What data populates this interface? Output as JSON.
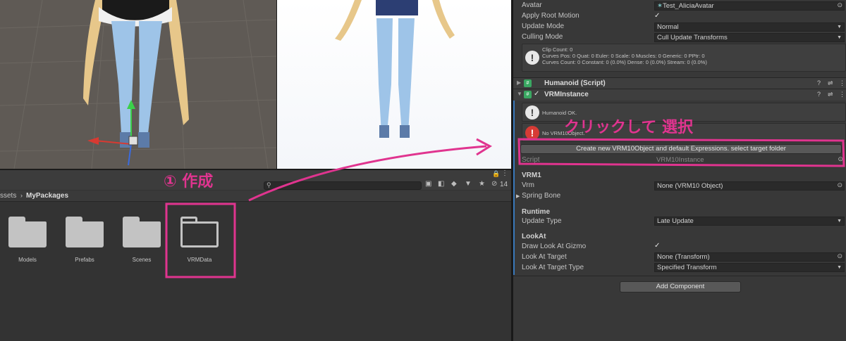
{
  "project": {
    "hidden_count": "14",
    "breadcrumb_root": "ssets",
    "breadcrumb_sep": "›",
    "breadcrumb_current": "MyPackages",
    "folders": [
      {
        "name": "Models"
      },
      {
        "name": "Prefabs"
      },
      {
        "name": "Scenes"
      },
      {
        "name": "VRMData"
      }
    ]
  },
  "inspector": {
    "animator": {
      "avatar_label": "Avatar",
      "avatar_value": "Test_AliciaAvatar",
      "apply_root_motion_label": "Apply Root Motion",
      "apply_root_motion_checked": "✓",
      "update_mode_label": "Update Mode",
      "update_mode_value": "Normal",
      "culling_mode_label": "Culling Mode",
      "culling_mode_value": "Cull Update Transforms",
      "info_lines": [
        "Clip Count: 0",
        "Curves Pos: 0 Quat: 0 Euler: 0 Scale: 0 Muscles: 0 Generic: 0 PPtr: 0",
        "Curves Count: 0 Constant: 0 (0.0%) Dense: 0 (0.0%) Stream: 0 (0.0%)"
      ]
    },
    "humanoid_title": "Humanoid (Script)",
    "vrm_instance": {
      "title": "VRMInstance",
      "enabled": "✓",
      "help_ok": "Humanoid OK.",
      "help_error": "No VRM10Object.",
      "create_button": "Create new VRM10Object and default Expressions. select target folder",
      "script_label": "Script",
      "script_value": "VRM10Instance",
      "vrm1_header": "VRM1",
      "vrm_label": "Vrm",
      "vrm_value": "None (VRM10 Object)",
      "spring_bone_label": "Spring Bone",
      "runtime_header": "Runtime",
      "update_type_label": "Update Type",
      "update_type_value": "Late Update",
      "lookat_header": "LookAt",
      "draw_gizmo_label": "Draw Look At Gizmo",
      "draw_gizmo_checked": "✓",
      "look_target_label": "Look At Target",
      "look_target_value": "None (Transform)",
      "look_target_type_label": "Look At Target Type",
      "look_target_type_value": "Specified Transform"
    },
    "add_component_button": "Add Component"
  },
  "annotations": {
    "step_marker": "① 作成",
    "click_select": "クリックして 選択",
    "color": "#e0348f"
  }
}
